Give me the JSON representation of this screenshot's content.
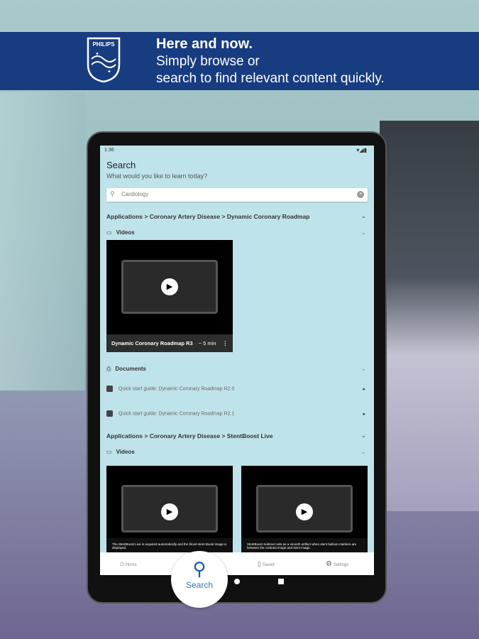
{
  "banner": {
    "logo_text": "PHILIPS",
    "line1": "Here and now.",
    "line2": "Simply browse or",
    "line3": "search to find relevant content quickly."
  },
  "status": {
    "time": "1:36",
    "right": "▾◢▮"
  },
  "page": {
    "title": "Search",
    "subtitle": "What would you like to learn today?"
  },
  "search": {
    "value": "Cardiology",
    "icon": "search-icon",
    "clear": "clear-icon"
  },
  "groups": [
    {
      "breadcrumb": "Applications > Coronary Artery Disease > Dynamic Coronary Roadmap",
      "videos_label": "Videos",
      "videos": [
        {
          "title": "Dynamic Coronary Roadmap R3",
          "duration": "~ 5 min"
        }
      ],
      "documents_label": "Documents",
      "documents": [
        "Quick start guide: Dynamic Coronary Roadmap R2.0",
        "Quick start guide: Dynamic Coronary Roadmap R2.1"
      ]
    },
    {
      "breadcrumb": "Applications > Coronary Artery Disease > StentBoost Live",
      "videos_label": "Videos",
      "videos": [
        {
          "caption": "The StentBoost Live is acquired automatically and the blood stent Boost image is displayed."
        },
        {
          "caption": "StentBoost Subtract sets as a smooth artifact when stent balloon markers are between the contrast image and stent image."
        }
      ]
    }
  ],
  "nav": {
    "home": "Home",
    "search": "Search",
    "saved": "Saved",
    "settings": "Settings"
  },
  "colors": {
    "banner": "#183c80",
    "screen": "#bfe3ea",
    "accent": "#1a5ea8"
  }
}
